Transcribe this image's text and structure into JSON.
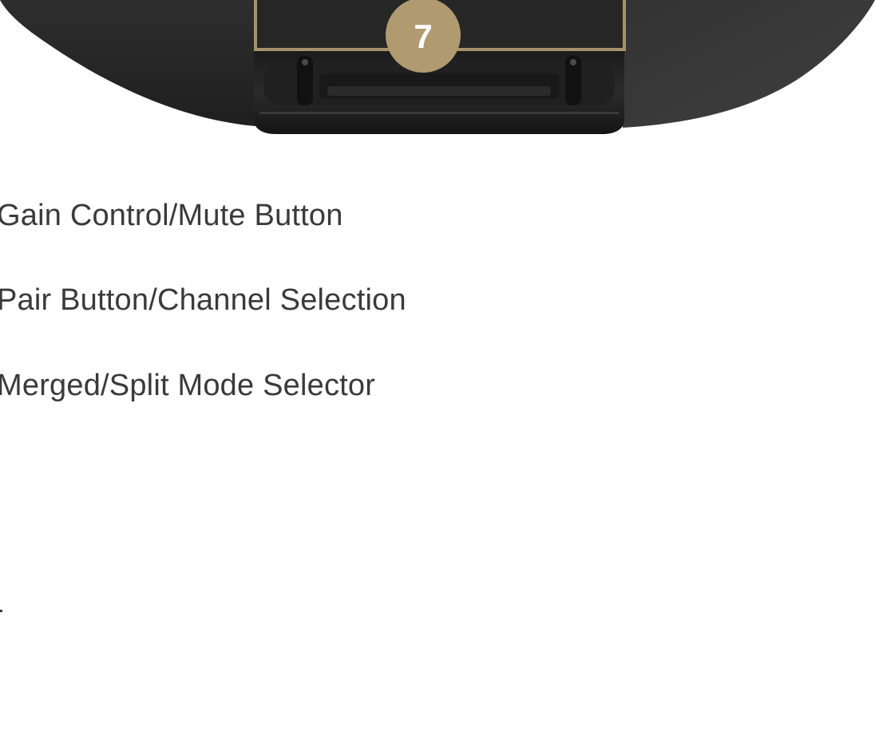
{
  "figure": {
    "callout_number": "7",
    "colors": {
      "device_body": "#2a2a2a",
      "accent_gold": "#a8926a",
      "callout_fill": "#b09a70"
    }
  },
  "features": {
    "items": [
      {
        "label": "Gain Control/Mute Button"
      },
      {
        "label": "Pair Button/Channel Selection"
      },
      {
        "label": "Merged/Split Mode Selector"
      }
    ]
  }
}
